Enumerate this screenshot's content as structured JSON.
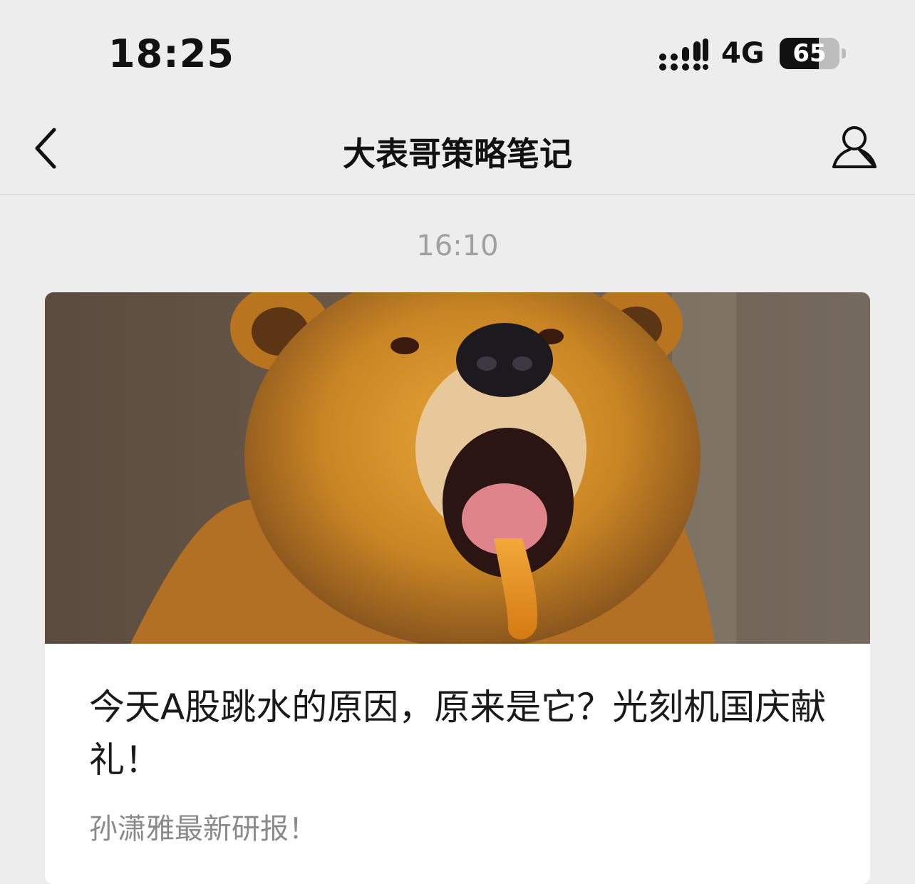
{
  "status_bar": {
    "time": "18:25",
    "network": "4G",
    "battery_level": "65",
    "battery_fraction": 0.65
  },
  "nav": {
    "title": "大表哥策略笔记",
    "back_icon": "chevron-left-icon",
    "profile_icon": "person-icon"
  },
  "chat": {
    "timestamp": "16:10"
  },
  "article": {
    "cover_icon": "bear-cover-image",
    "title": "今天A股跳水的原因，原来是它？光刻机国庆献礼！",
    "digest": "孙潇雅最新研报！"
  },
  "colors": {
    "background": "#ededed",
    "card": "#ffffff",
    "muted_text": "#8a8a8a",
    "timestamp_text": "#a0a0a0"
  }
}
